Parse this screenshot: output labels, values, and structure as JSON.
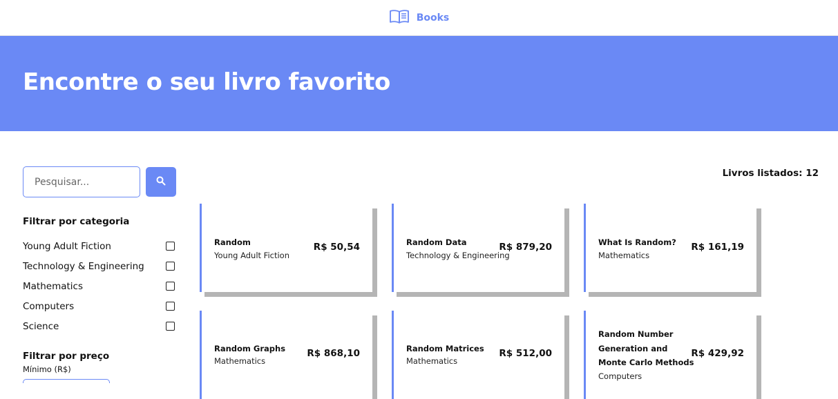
{
  "header": {
    "brand_label": "Books"
  },
  "hero": {
    "title": "Encontre o seu livro favorito"
  },
  "search": {
    "placeholder": "Pesquisar..."
  },
  "filters": {
    "category_heading": "Filtrar por categoria",
    "categories": [
      {
        "label": "Young Adult Fiction",
        "checked": false
      },
      {
        "label": "Technology & Engineering",
        "checked": false
      },
      {
        "label": "Mathematics",
        "checked": false
      },
      {
        "label": "Computers",
        "checked": false
      },
      {
        "label": "Science",
        "checked": false
      }
    ],
    "price_heading": "Filtrar por preço",
    "min_label": "Mínimo (R$)"
  },
  "results": {
    "count_text": "Livros listados: 12"
  },
  "books": [
    {
      "title": "Random",
      "category": "Young Adult Fiction",
      "price": "R$ 50,54"
    },
    {
      "title": "Random Data",
      "category": "Technology & Engineering",
      "price": "R$ 879,20"
    },
    {
      "title": "What Is Random?",
      "category": "Mathematics",
      "price": "R$ 161,19"
    },
    {
      "title": "Random Graphs",
      "category": "Mathematics",
      "price": "R$ 868,10"
    },
    {
      "title": "Random Matrices",
      "category": "Mathematics",
      "price": "R$ 512,00"
    },
    {
      "title": "Random Number Generation and Monte Carlo Methods",
      "category": "Computers",
      "price": "R$ 429,92"
    }
  ],
  "colors": {
    "accent": "#6a89f5",
    "card_shadow": "#b5b5b5"
  }
}
